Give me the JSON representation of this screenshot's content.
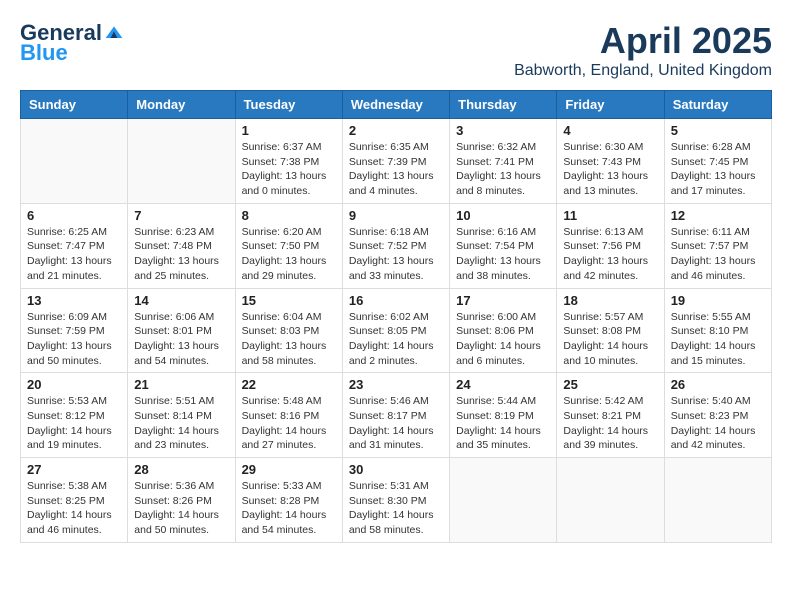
{
  "header": {
    "logo_general": "General",
    "logo_blue": "Blue",
    "month_title": "April 2025",
    "location": "Babworth, England, United Kingdom"
  },
  "weekdays": [
    "Sunday",
    "Monday",
    "Tuesday",
    "Wednesday",
    "Thursday",
    "Friday",
    "Saturday"
  ],
  "weeks": [
    [
      {
        "day": "",
        "info": ""
      },
      {
        "day": "",
        "info": ""
      },
      {
        "day": "1",
        "info": "Sunrise: 6:37 AM\nSunset: 7:38 PM\nDaylight: 13 hours and 0 minutes."
      },
      {
        "day": "2",
        "info": "Sunrise: 6:35 AM\nSunset: 7:39 PM\nDaylight: 13 hours and 4 minutes."
      },
      {
        "day": "3",
        "info": "Sunrise: 6:32 AM\nSunset: 7:41 PM\nDaylight: 13 hours and 8 minutes."
      },
      {
        "day": "4",
        "info": "Sunrise: 6:30 AM\nSunset: 7:43 PM\nDaylight: 13 hours and 13 minutes."
      },
      {
        "day": "5",
        "info": "Sunrise: 6:28 AM\nSunset: 7:45 PM\nDaylight: 13 hours and 17 minutes."
      }
    ],
    [
      {
        "day": "6",
        "info": "Sunrise: 6:25 AM\nSunset: 7:47 PM\nDaylight: 13 hours and 21 minutes."
      },
      {
        "day": "7",
        "info": "Sunrise: 6:23 AM\nSunset: 7:48 PM\nDaylight: 13 hours and 25 minutes."
      },
      {
        "day": "8",
        "info": "Sunrise: 6:20 AM\nSunset: 7:50 PM\nDaylight: 13 hours and 29 minutes."
      },
      {
        "day": "9",
        "info": "Sunrise: 6:18 AM\nSunset: 7:52 PM\nDaylight: 13 hours and 33 minutes."
      },
      {
        "day": "10",
        "info": "Sunrise: 6:16 AM\nSunset: 7:54 PM\nDaylight: 13 hours and 38 minutes."
      },
      {
        "day": "11",
        "info": "Sunrise: 6:13 AM\nSunset: 7:56 PM\nDaylight: 13 hours and 42 minutes."
      },
      {
        "day": "12",
        "info": "Sunrise: 6:11 AM\nSunset: 7:57 PM\nDaylight: 13 hours and 46 minutes."
      }
    ],
    [
      {
        "day": "13",
        "info": "Sunrise: 6:09 AM\nSunset: 7:59 PM\nDaylight: 13 hours and 50 minutes."
      },
      {
        "day": "14",
        "info": "Sunrise: 6:06 AM\nSunset: 8:01 PM\nDaylight: 13 hours and 54 minutes."
      },
      {
        "day": "15",
        "info": "Sunrise: 6:04 AM\nSunset: 8:03 PM\nDaylight: 13 hours and 58 minutes."
      },
      {
        "day": "16",
        "info": "Sunrise: 6:02 AM\nSunset: 8:05 PM\nDaylight: 14 hours and 2 minutes."
      },
      {
        "day": "17",
        "info": "Sunrise: 6:00 AM\nSunset: 8:06 PM\nDaylight: 14 hours and 6 minutes."
      },
      {
        "day": "18",
        "info": "Sunrise: 5:57 AM\nSunset: 8:08 PM\nDaylight: 14 hours and 10 minutes."
      },
      {
        "day": "19",
        "info": "Sunrise: 5:55 AM\nSunset: 8:10 PM\nDaylight: 14 hours and 15 minutes."
      }
    ],
    [
      {
        "day": "20",
        "info": "Sunrise: 5:53 AM\nSunset: 8:12 PM\nDaylight: 14 hours and 19 minutes."
      },
      {
        "day": "21",
        "info": "Sunrise: 5:51 AM\nSunset: 8:14 PM\nDaylight: 14 hours and 23 minutes."
      },
      {
        "day": "22",
        "info": "Sunrise: 5:48 AM\nSunset: 8:16 PM\nDaylight: 14 hours and 27 minutes."
      },
      {
        "day": "23",
        "info": "Sunrise: 5:46 AM\nSunset: 8:17 PM\nDaylight: 14 hours and 31 minutes."
      },
      {
        "day": "24",
        "info": "Sunrise: 5:44 AM\nSunset: 8:19 PM\nDaylight: 14 hours and 35 minutes."
      },
      {
        "day": "25",
        "info": "Sunrise: 5:42 AM\nSunset: 8:21 PM\nDaylight: 14 hours and 39 minutes."
      },
      {
        "day": "26",
        "info": "Sunrise: 5:40 AM\nSunset: 8:23 PM\nDaylight: 14 hours and 42 minutes."
      }
    ],
    [
      {
        "day": "27",
        "info": "Sunrise: 5:38 AM\nSunset: 8:25 PM\nDaylight: 14 hours and 46 minutes."
      },
      {
        "day": "28",
        "info": "Sunrise: 5:36 AM\nSunset: 8:26 PM\nDaylight: 14 hours and 50 minutes."
      },
      {
        "day": "29",
        "info": "Sunrise: 5:33 AM\nSunset: 8:28 PM\nDaylight: 14 hours and 54 minutes."
      },
      {
        "day": "30",
        "info": "Sunrise: 5:31 AM\nSunset: 8:30 PM\nDaylight: 14 hours and 58 minutes."
      },
      {
        "day": "",
        "info": ""
      },
      {
        "day": "",
        "info": ""
      },
      {
        "day": "",
        "info": ""
      }
    ]
  ]
}
